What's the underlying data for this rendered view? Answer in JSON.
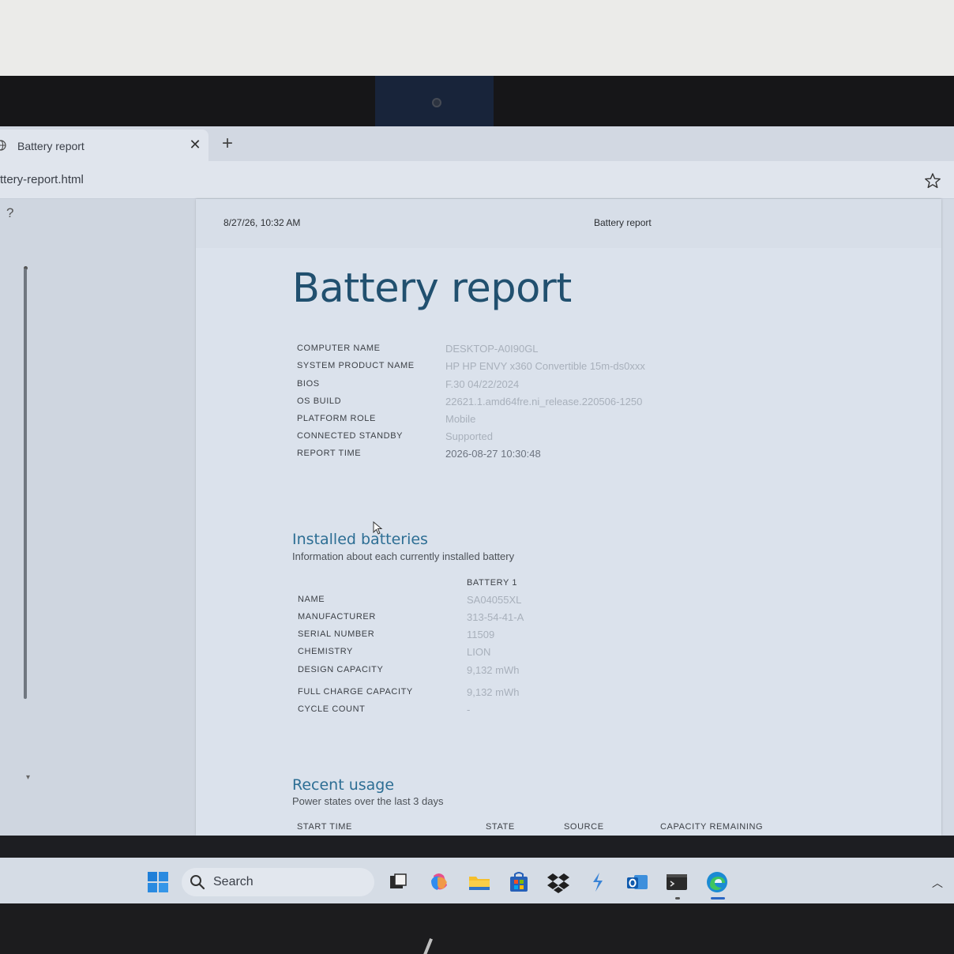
{
  "browser": {
    "tab_title": "Battery report",
    "address_text": "ttery-report.html",
    "help_label": "?"
  },
  "page": {
    "header_date": "8/27/26, 10:32 AM",
    "header_title": "Battery report",
    "title": "Battery report"
  },
  "system_info": [
    {
      "key": "COMPUTER NAME",
      "value": "DESKTOP-A0I90GL"
    },
    {
      "key": "SYSTEM PRODUCT NAME",
      "value": "HP HP ENVY x360 Convertible 15m-ds0xxx"
    },
    {
      "key": "BIOS",
      "value": "F.30 04/22/2024"
    },
    {
      "key": "OS BUILD",
      "value": "22621.1.amd64fre.ni_release.220506-1250"
    },
    {
      "key": "PLATFORM ROLE",
      "value": "Mobile"
    },
    {
      "key": "CONNECTED STANDBY",
      "value": "Supported"
    },
    {
      "key": "REPORT TIME",
      "value": "2026-08-27  10:30:48"
    }
  ],
  "installed_batteries": {
    "title": "Installed batteries",
    "subtitle": "Information about each currently installed battery",
    "column_header": "BATTERY 1",
    "rows": [
      {
        "key": "NAME",
        "value": "SA04055XL"
      },
      {
        "key": "MANUFACTURER",
        "value": "313-54-41-A"
      },
      {
        "key": "SERIAL NUMBER",
        "value": "11509"
      },
      {
        "key": "CHEMISTRY",
        "value": "LION"
      },
      {
        "key": "DESIGN CAPACITY",
        "value": "9,132 mWh"
      },
      {
        "key": "FULL CHARGE CAPACITY",
        "value": "9,132 mWh"
      },
      {
        "key": "CYCLE COUNT",
        "value": "-"
      }
    ]
  },
  "recent_usage": {
    "title": "Recent usage",
    "subtitle": "Power states over the last 3 days",
    "columns": [
      "START TIME",
      "STATE",
      "SOURCE",
      "CAPACITY REMAINING"
    ]
  },
  "taskbar": {
    "search_label": "Search",
    "icons": [
      "task-view-icon",
      "copilot-icon",
      "file-explorer-icon",
      "store-icon",
      "dropbox-icon",
      "app-icon",
      "outlook-icon",
      "terminal-icon",
      "edge-icon"
    ]
  },
  "colors": {
    "title": "#21506f",
    "section_title": "#2d6e94",
    "value_text": "#a8b0bb"
  }
}
